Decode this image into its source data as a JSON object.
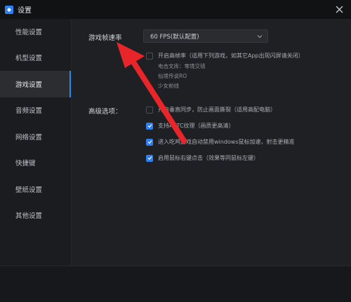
{
  "window": {
    "title": "设置"
  },
  "sidebar": {
    "items": [
      {
        "label": "性能设置"
      },
      {
        "label": "机型设置"
      },
      {
        "label": "游戏设置",
        "active": true
      },
      {
        "label": "音频设置"
      },
      {
        "label": "网络设置"
      },
      {
        "label": "快捷键"
      },
      {
        "label": "壁纸设置"
      },
      {
        "label": "其他设置"
      }
    ]
  },
  "main": {
    "frame_rate_label": "游戏帧速率",
    "frame_rate_value": "60 FPS(默认配置)",
    "high_fps": {
      "label": "开启高帧率（适用下列游戏，如其它App出现闪屏请关闭）",
      "checked": false,
      "games": [
        "电击文库：零境交错",
        "仙境传说RO",
        "少女前线"
      ]
    },
    "advanced_label": "高级选项：",
    "options": [
      {
        "label": "开启垂直同步，防止画面撕裂（适用高配电脑）",
        "checked": false
      },
      {
        "label": "支持ASTC纹理（画质更高清）",
        "checked": true
      },
      {
        "label": "进入吃鸡游戏自动禁用windows鼠标加速，射击更精准",
        "checked": true
      },
      {
        "label": "启用鼠标右键点击（效果等同鼠标左键）",
        "checked": true
      }
    ]
  },
  "colors": {
    "accent": "#2f7ff0",
    "annotation": "#e8262a"
  }
}
